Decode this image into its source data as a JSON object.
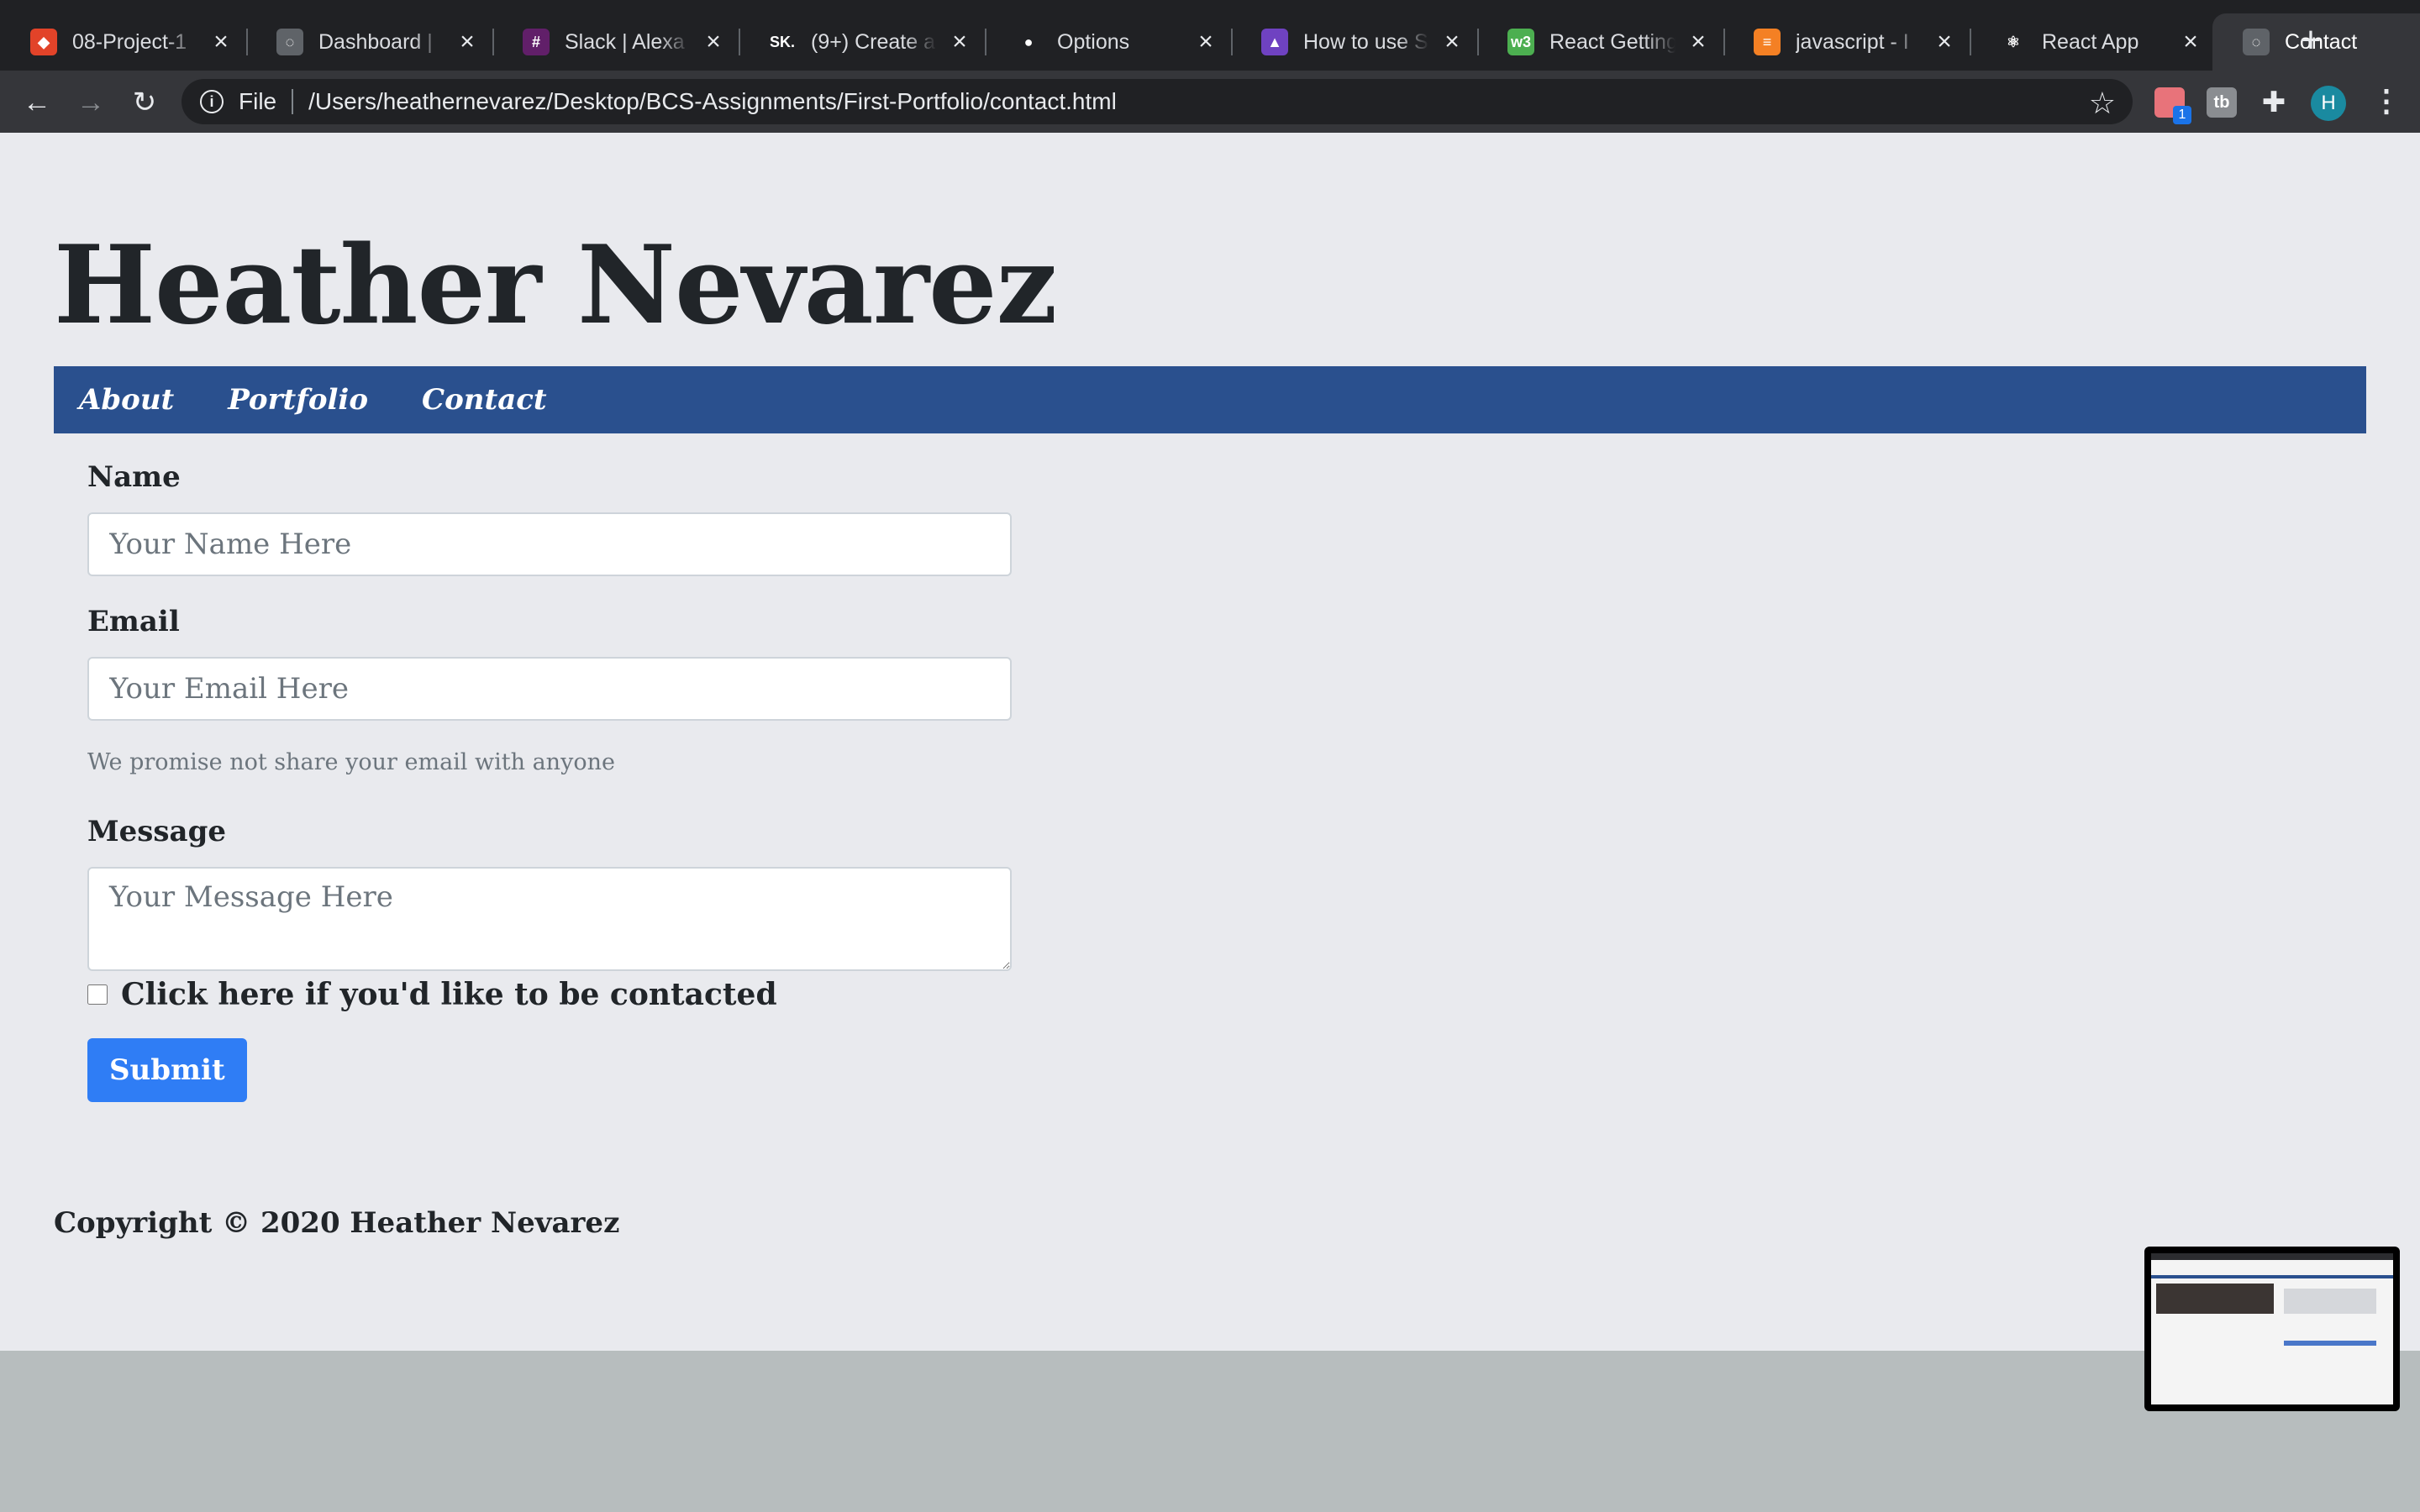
{
  "browser": {
    "tabs": [
      {
        "title": "08-Project-1",
        "icon": "gitlab-icon",
        "color": "#e24329",
        "glyph": "◆"
      },
      {
        "title": "Dashboard | ",
        "icon": "globe-icon",
        "color": "#5f6368",
        "glyph": "◌"
      },
      {
        "title": "Slack | Alexa",
        "icon": "slack-icon",
        "color": "#611f69",
        "glyph": "#"
      },
      {
        "title": "(9+) Create a",
        "icon": "sk-icon",
        "color": "#202124",
        "glyph": "SK."
      },
      {
        "title": "Options",
        "icon": "github-icon",
        "color": "#202124",
        "glyph": "●"
      },
      {
        "title": "How to use S",
        "icon": "rocket-icon",
        "color": "#6f42c1",
        "glyph": "▲"
      },
      {
        "title": "React Getting",
        "icon": "w3-icon",
        "color": "#4caf50",
        "glyph": "w3"
      },
      {
        "title": "javascript - I",
        "icon": "stackoverflow-icon",
        "color": "#f48024",
        "glyph": "≡"
      },
      {
        "title": "React App",
        "icon": "react-icon",
        "color": "#202124",
        "glyph": "⚛"
      },
      {
        "title": "Contact",
        "icon": "globe-icon",
        "color": "#5f6368",
        "glyph": "◌",
        "active": true
      }
    ],
    "address": {
      "scheme": "File",
      "url": "/Users/heathernevarez/Desktop/BCS-Assignments/First-Portfolio/contact.html"
    },
    "extensions": {
      "badge_count": "1",
      "tb_label": "tb"
    },
    "avatar_letter": "H"
  },
  "site": {
    "title": "Heather Nevarez",
    "nav": [
      "About",
      "Portfolio",
      "Contact"
    ]
  },
  "form": {
    "name_label": "Name",
    "name_placeholder": "Your Name Here",
    "email_label": "Email",
    "email_placeholder": "Your Email Here",
    "email_help": "We promise not share your email with anyone",
    "message_label": "Message",
    "message_placeholder": "Your Message Here",
    "checkbox_label": "Click here if you'd like to be contacted",
    "submit_label": "Submit"
  },
  "footer": {
    "copyright": "Copyright © 2020 Heather Nevarez"
  },
  "colors": {
    "nav_bg": "#2a508e",
    "page_bg": "#e9eaee",
    "submit_bg": "#2f7df5"
  }
}
